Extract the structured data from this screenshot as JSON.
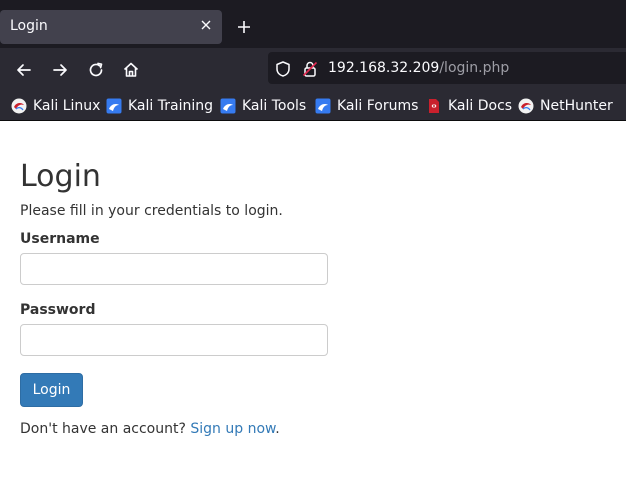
{
  "browser": {
    "tab": {
      "title": "Login"
    },
    "url": {
      "host": "192.168.32.209",
      "path": "/login.php"
    },
    "bookmarks": [
      {
        "label": "Kali Linux",
        "icon": "kali-dragon-icon"
      },
      {
        "label": "Kali Training",
        "icon": "kali-training-icon"
      },
      {
        "label": "Kali Tools",
        "icon": "kali-tools-icon"
      },
      {
        "label": "Kali Forums",
        "icon": "kali-forums-icon"
      },
      {
        "label": "Kali Docs",
        "icon": "kali-docs-icon"
      },
      {
        "label": "NetHunter",
        "icon": "nethunter-icon"
      }
    ]
  },
  "login": {
    "title": "Login",
    "subtitle": "Please fill in your credentials to login.",
    "username_label": "Username",
    "username_value": "",
    "password_label": "Password",
    "password_value": "",
    "submit_label": "Login",
    "signup_prompt": "Don't have an account?",
    "signup_link": "Sign up now",
    "signup_suffix": "."
  },
  "colors": {
    "primary": "#337ab7",
    "text": "#333333",
    "chrome_dark": "#1c1b22",
    "chrome": "#2b2a33"
  }
}
